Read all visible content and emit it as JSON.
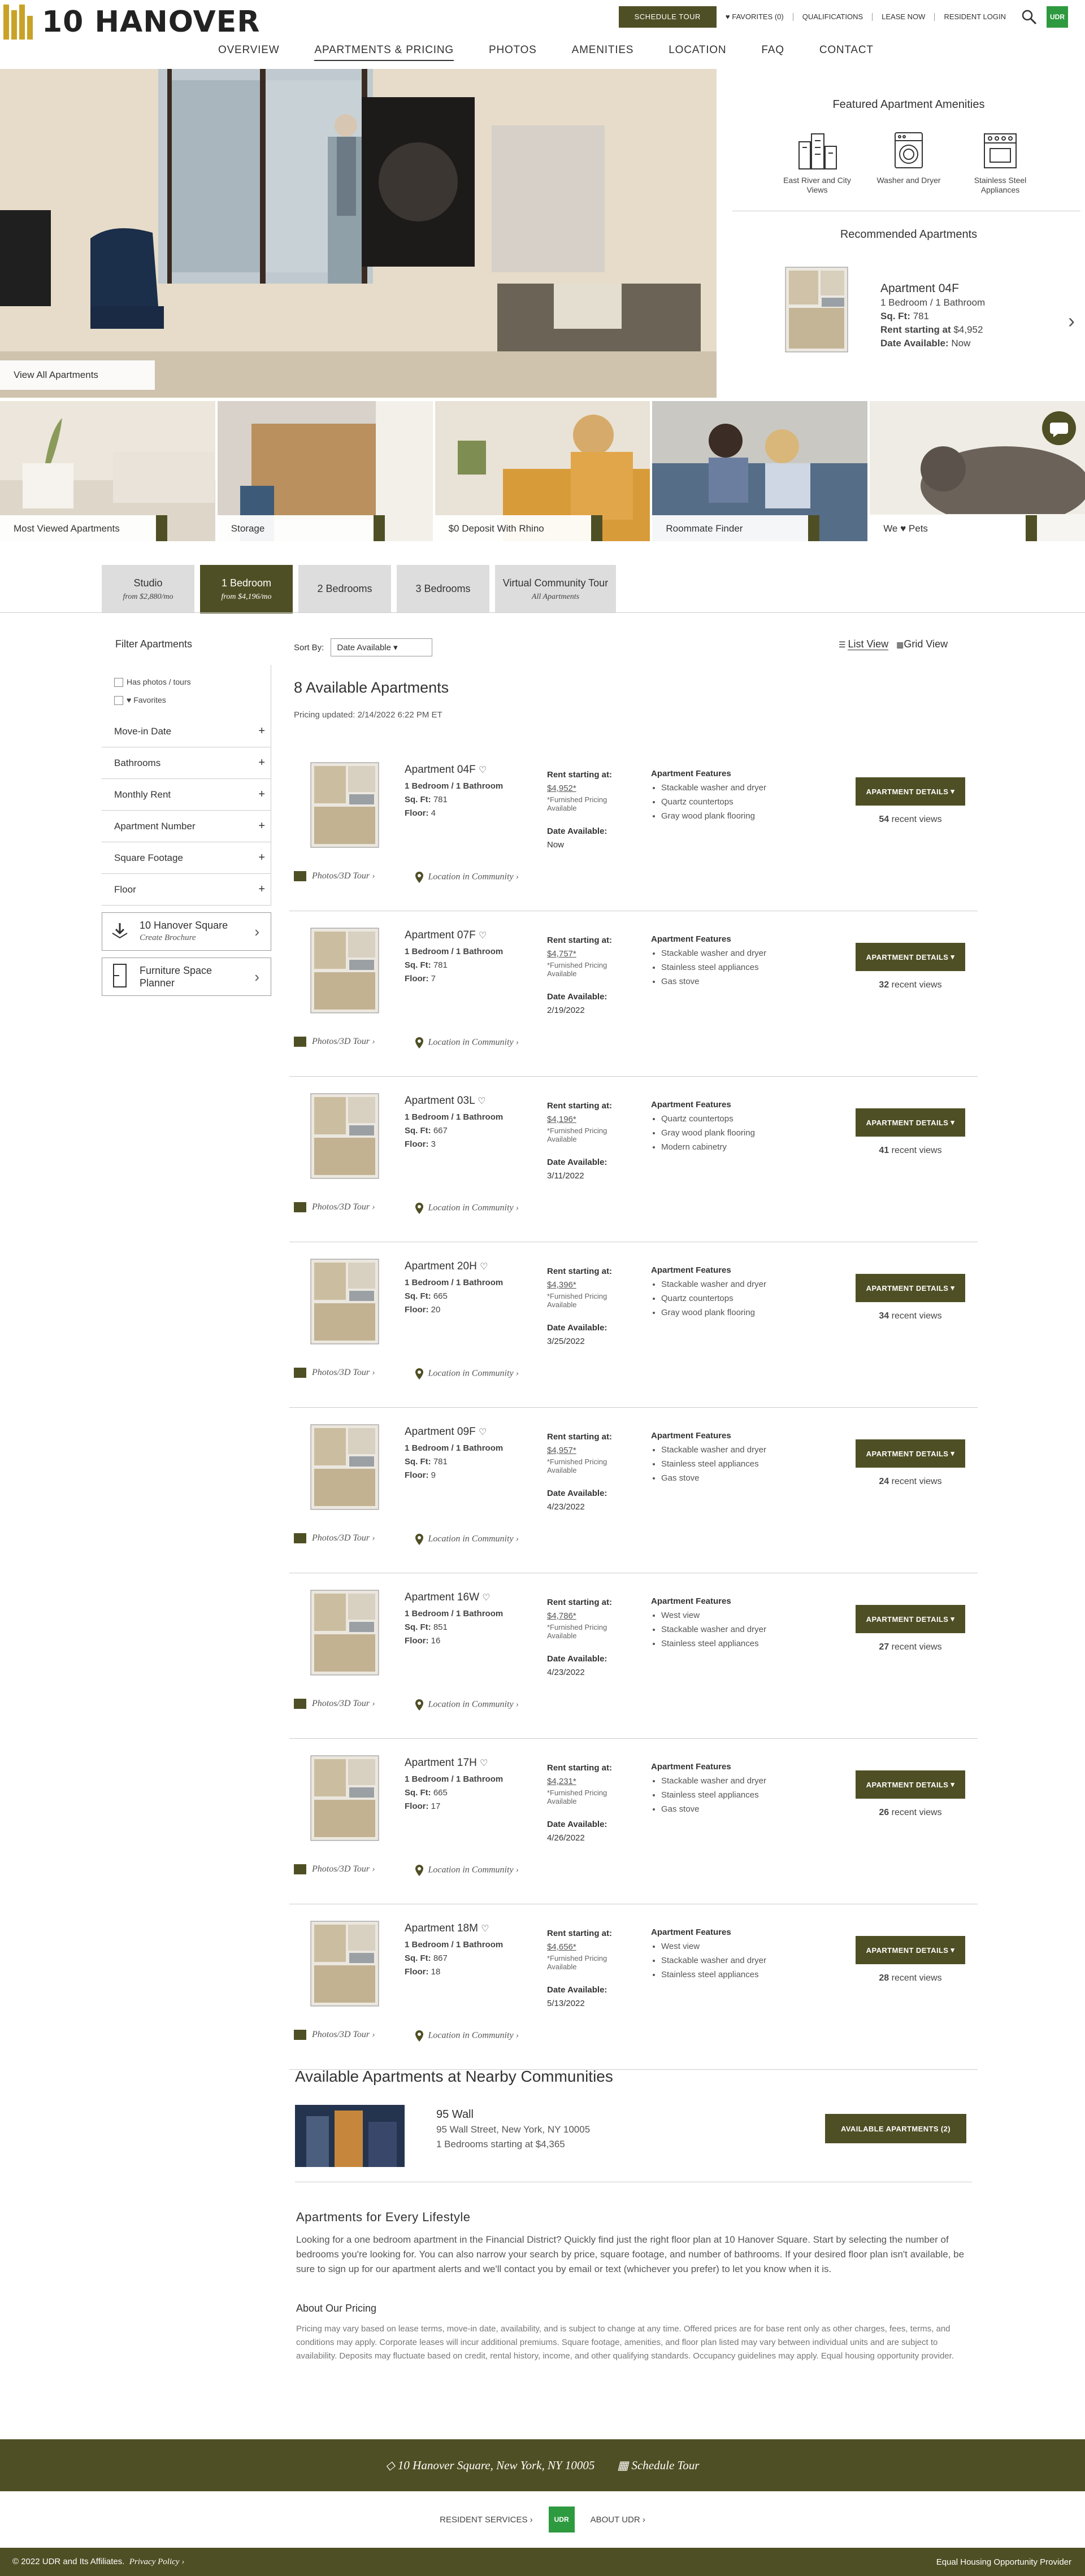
{
  "brand": {
    "name": "10 HANOVER",
    "accent": "#4f4f25",
    "gold": "#c9a227",
    "udr_green": "#2e9a3f"
  },
  "utility": {
    "schedule_tour": "SCHEDULE TOUR",
    "favorites": "FAVORITES (0)",
    "qualifications": "QUALIFICATIONS",
    "lease_now": "LEASE NOW",
    "resident_login": "RESIDENT LOGIN",
    "udr": "UDR"
  },
  "nav": [
    "OVERVIEW",
    "APARTMENTS & PRICING",
    "PHOTOS",
    "AMENITIES",
    "LOCATION",
    "FAQ",
    "CONTACT"
  ],
  "hero": {
    "view_all": "View All Apartments"
  },
  "featured": {
    "title": "Featured Apartment Amenities",
    "items": [
      {
        "icon": "city-buildings-icon",
        "label": "East River and City Views"
      },
      {
        "icon": "washer-icon",
        "label": "Washer and Dryer"
      },
      {
        "icon": "stove-icon",
        "label": "Stainless Steel Appliances"
      }
    ]
  },
  "recommended": {
    "title": "Recommended Apartments",
    "name": "Apartment 04F",
    "beds": "1 Bedroom / 1 Bathroom",
    "sqft_label": "Sq. Ft:",
    "sqft": "781",
    "rent_label": "Rent starting at",
    "rent": "$4,952",
    "date_label": "Date Available:",
    "date": "Now"
  },
  "tiles": [
    "Most Viewed Apartments",
    "Storage",
    "$0 Deposit With Rhino",
    "Roommate Finder",
    "We ♥ Pets"
  ],
  "tabs": [
    {
      "label": "Studio",
      "sub": "from $2,880/mo"
    },
    {
      "label": "1 Bedroom",
      "sub": "from $4,196/mo"
    },
    {
      "label": "2 Bedrooms",
      "sub": ""
    },
    {
      "label": "3 Bedrooms",
      "sub": ""
    },
    {
      "label": "Virtual Community Tour",
      "sub": "All Apartments"
    }
  ],
  "filters": {
    "title": "Filter Apartments",
    "has_photos": "Has photos / tours",
    "favorites": "Favorites",
    "rows": [
      "Move-in Date",
      "Bathrooms",
      "Monthly Rent",
      "Apartment Number",
      "Square Footage",
      "Floor"
    ],
    "brochure": {
      "title": "10 Hanover Square",
      "sub": "Create Brochure"
    },
    "planner": {
      "title": "Furniture Space Planner"
    }
  },
  "sort": {
    "label": "Sort By:",
    "value": "Date Available"
  },
  "view_toggle": {
    "list": "List View",
    "grid": "Grid View"
  },
  "results": {
    "count_text": "8 Available Apartments",
    "updated": "Pricing updated: 2/14/2022 6:22 PM ET"
  },
  "labels": {
    "beds": "1 Bedroom / 1 Bathroom",
    "sqft": "Sq. Ft:",
    "floor": "Floor:",
    "rent": "Rent starting at:",
    "furnished": "*Furnished Pricing Available",
    "date": "Date Available:",
    "features": "Apartment Features",
    "details_btn": "APARTMENT DETAILS",
    "recent_views": "recent views",
    "photos_tour": "Photos/3D Tour ›",
    "location": "Location in Community ›"
  },
  "apartments": [
    {
      "name": "Apartment 04F",
      "sqft": "781",
      "floor": "4",
      "rent": "$4,952*",
      "date": "Now",
      "features": [
        "Stackable washer and dryer",
        "Quartz countertops",
        "Gray wood plank flooring"
      ],
      "views": "54"
    },
    {
      "name": "Apartment 07F",
      "sqft": "781",
      "floor": "7",
      "rent": "$4,757*",
      "date": "2/19/2022",
      "features": [
        "Stackable washer and dryer",
        "Stainless steel appliances",
        "Gas stove"
      ],
      "views": "32"
    },
    {
      "name": "Apartment 03L",
      "sqft": "667",
      "floor": "3",
      "rent": "$4,196*",
      "date": "3/11/2022",
      "features": [
        "Quartz countertops",
        "Gray wood plank flooring",
        "Modern cabinetry"
      ],
      "views": "41"
    },
    {
      "name": "Apartment 20H",
      "sqft": "665",
      "floor": "20",
      "rent": "$4,396*",
      "date": "3/25/2022",
      "features": [
        "Stackable washer and dryer",
        "Quartz countertops",
        "Gray wood plank flooring"
      ],
      "views": "34"
    },
    {
      "name": "Apartment 09F",
      "sqft": "781",
      "floor": "9",
      "rent": "$4,957*",
      "date": "4/23/2022",
      "features": [
        "Stackable washer and dryer",
        "Stainless steel appliances",
        "Gas stove"
      ],
      "views": "24"
    },
    {
      "name": "Apartment 16W",
      "sqft": "851",
      "floor": "16",
      "rent": "$4,786*",
      "date": "4/23/2022",
      "features": [
        "West view",
        "Stackable washer and dryer",
        "Stainless steel appliances"
      ],
      "views": "27"
    },
    {
      "name": "Apartment 17H",
      "sqft": "665",
      "floor": "17",
      "rent": "$4,231*",
      "date": "4/26/2022",
      "features": [
        "Stackable washer and dryer",
        "Stainless steel appliances",
        "Gas stove"
      ],
      "views": "26"
    },
    {
      "name": "Apartment 18M",
      "sqft": "867",
      "floor": "18",
      "rent": "$4,656*",
      "date": "5/13/2022",
      "features": [
        "West view",
        "Stackable washer and dryer",
        "Stainless steel appliances"
      ],
      "views": "28"
    }
  ],
  "nearby": {
    "title": "Available Apartments at Nearby Communities",
    "name": "95 Wall",
    "address": "95 Wall Street, New York, NY 10005",
    "starting": "1 Bedrooms starting at $4,365",
    "button": "AVAILABLE APARTMENTS (2)"
  },
  "lifestyle": {
    "title": "Apartments for Every Lifestyle",
    "body": "Looking for a one bedroom apartment in the Financial District? Quickly find just the right floor plan at 10 Hanover Square. Start by selecting the number of bedrooms you're looking for. You can also narrow your search by price, square footage, and number of bathrooms. If your desired floor plan isn't available, be sure to sign up for our apartment alerts and we'll contact you by email or text (whichever you prefer) to let you know when it is.",
    "pricing_title": "About Our Pricing",
    "pricing_body": "Pricing may vary based on lease terms, move-in date, availability, and is subject to change at any time. Offered prices are for base rent only as other charges, fees, terms, and conditions may apply. Corporate leases will incur additional premiums. Square footage, amenities, and floor plan listed may vary between individual units and are subject to availability. Deposits may fluctuate based on credit, rental history, income, and other qualifying standards. Occupancy guidelines may apply. Equal housing opportunity provider."
  },
  "footer": {
    "address": "10 Hanover Square, New York, NY 10005",
    "schedule": "Schedule Tour",
    "resident_services": "RESIDENT SERVICES ›",
    "about": "ABOUT UDR ›",
    "udr": "UDR",
    "copyright": "© 2022 UDR and Its Affiliates.",
    "privacy": "Privacy Policy ›",
    "eho": "Equal Housing Opportunity Provider"
  }
}
